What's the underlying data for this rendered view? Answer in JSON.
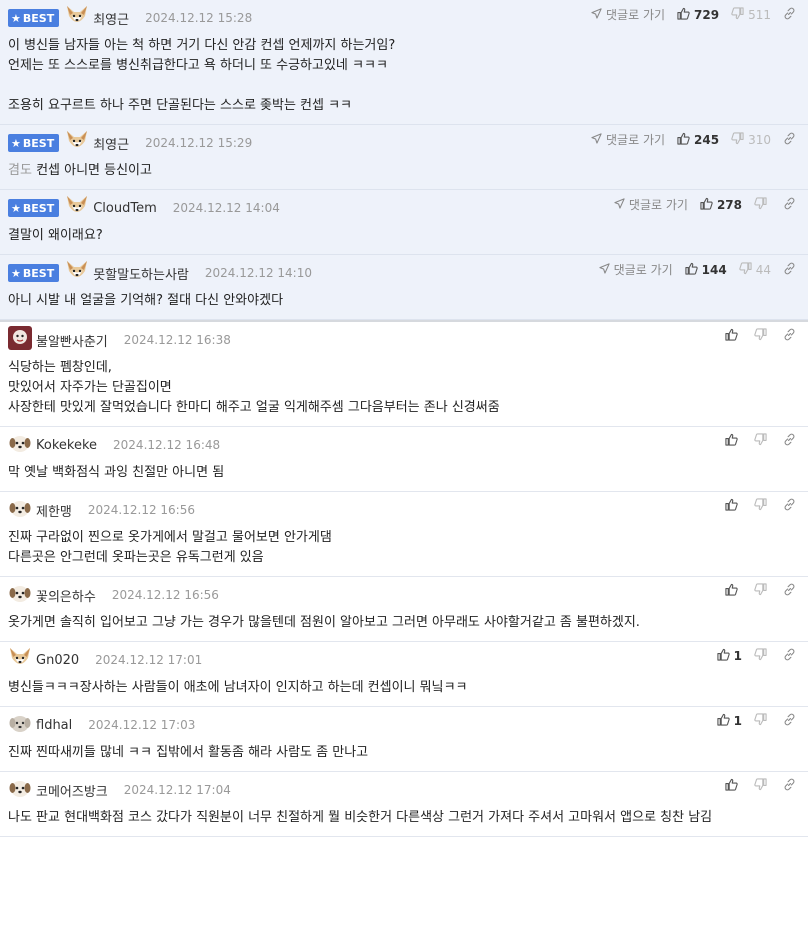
{
  "labels": {
    "best": "BEST",
    "goto": "댓글로 가기"
  },
  "colors": {
    "best_bg": "#eef2fa",
    "badge": "#4a7fe0"
  },
  "best_comments": [
    {
      "nick": "최영근",
      "date": "2024.12.12 15:28",
      "up": "729",
      "down": "511",
      "avatar": "dog-avatar",
      "body": "이 병신들 남자들 아는 척 하면 거기 다신 안감 컨셉 언제까지 하는거임?\n언제는 또 스스로를 병신취급한다고 욕 하더니 또 수긍하고있네 ㅋㅋㅋ\n\n조용히 요구르트 하나 주면 단골된다는 스스로 좆박는 컨셉 ㅋㅋ",
      "prefix": ""
    },
    {
      "nick": "최영근",
      "date": "2024.12.12 15:29",
      "up": "245",
      "down": "310",
      "avatar": "dog-avatar",
      "prefix": "겸도",
      "body": "컨셉 아니면 등신이고"
    },
    {
      "nick": "CloudTem",
      "date": "2024.12.12 14:04",
      "up": "278",
      "down": "",
      "avatar": "dog-avatar",
      "prefix": "",
      "body": "결말이 왜이래요?"
    },
    {
      "nick": "못할말도하는사람",
      "date": "2024.12.12 14:10",
      "up": "144",
      "down": "44",
      "avatar": "dog-avatar",
      "prefix": "",
      "body": "아니 시발 내 얼굴을 기억해? 절대 다신 안와야겠다"
    }
  ],
  "comments": [
    {
      "nick": "불알빤사춘기",
      "date": "2024.12.12 16:38",
      "up": "",
      "avatar": "photo-avatar",
      "body": "식당하는 펨창인데,\n맛있어서 자주가는 단골집이면\n사장한테 맛있게 잘먹었습니다 한마디 해주고 얼굴 익게해주셈 그다음부터는 존나 신경써줌"
    },
    {
      "nick": "Kokekeke",
      "date": "2024.12.12 16:48",
      "up": "",
      "avatar": "puppy-avatar",
      "body": "막 옛날 백화점식 과잉 친절만 아니면 됨"
    },
    {
      "nick": "제한맹",
      "date": "2024.12.12 16:56",
      "up": "",
      "avatar": "puppy-avatar",
      "body": "진짜 구라없이 찐으로 옷가게에서 말걸고 물어보면 안가게댐\n다른곳은 안그런데 옷파는곳은 유독그런게 있음"
    },
    {
      "nick": "꽃의은하수",
      "date": "2024.12.12 16:56",
      "up": "",
      "avatar": "puppy-avatar",
      "body": "옷가게면 솔직히 입어보고 그냥 가는 경우가 많을텐데 점원이 알아보고 그러면 아무래도 사야할거같고 좀 불편하겠지."
    },
    {
      "nick": "Gn020",
      "date": "2024.12.12 17:01",
      "up": "1",
      "avatar": "dog-avatar",
      "body": "병신들ㅋㅋㅋ장사하는 사람들이 애초에 남녀자이 인지하고 하는데 컨셉이니 뭐닠ㅋㅋ"
    },
    {
      "nick": "fldhal",
      "date": "2024.12.12 17:03",
      "up": "1",
      "avatar": "gray-puppy-avatar",
      "body": "진짜 찐따새끼들 많네 ㅋㅋ 집밖에서 활동좀 해라 사람도 좀 만나고"
    },
    {
      "nick": "코메어즈방크",
      "date": "2024.12.12 17:04",
      "up": "",
      "avatar": "puppy-avatar",
      "body": "나도 판교 현대백화점 코스 갔다가 직원분이 너무 친절하게 뭘 비슷한거 다른색상 그런거 가져다 주셔서 고마워서 앱으로 칭찬 남김"
    }
  ]
}
